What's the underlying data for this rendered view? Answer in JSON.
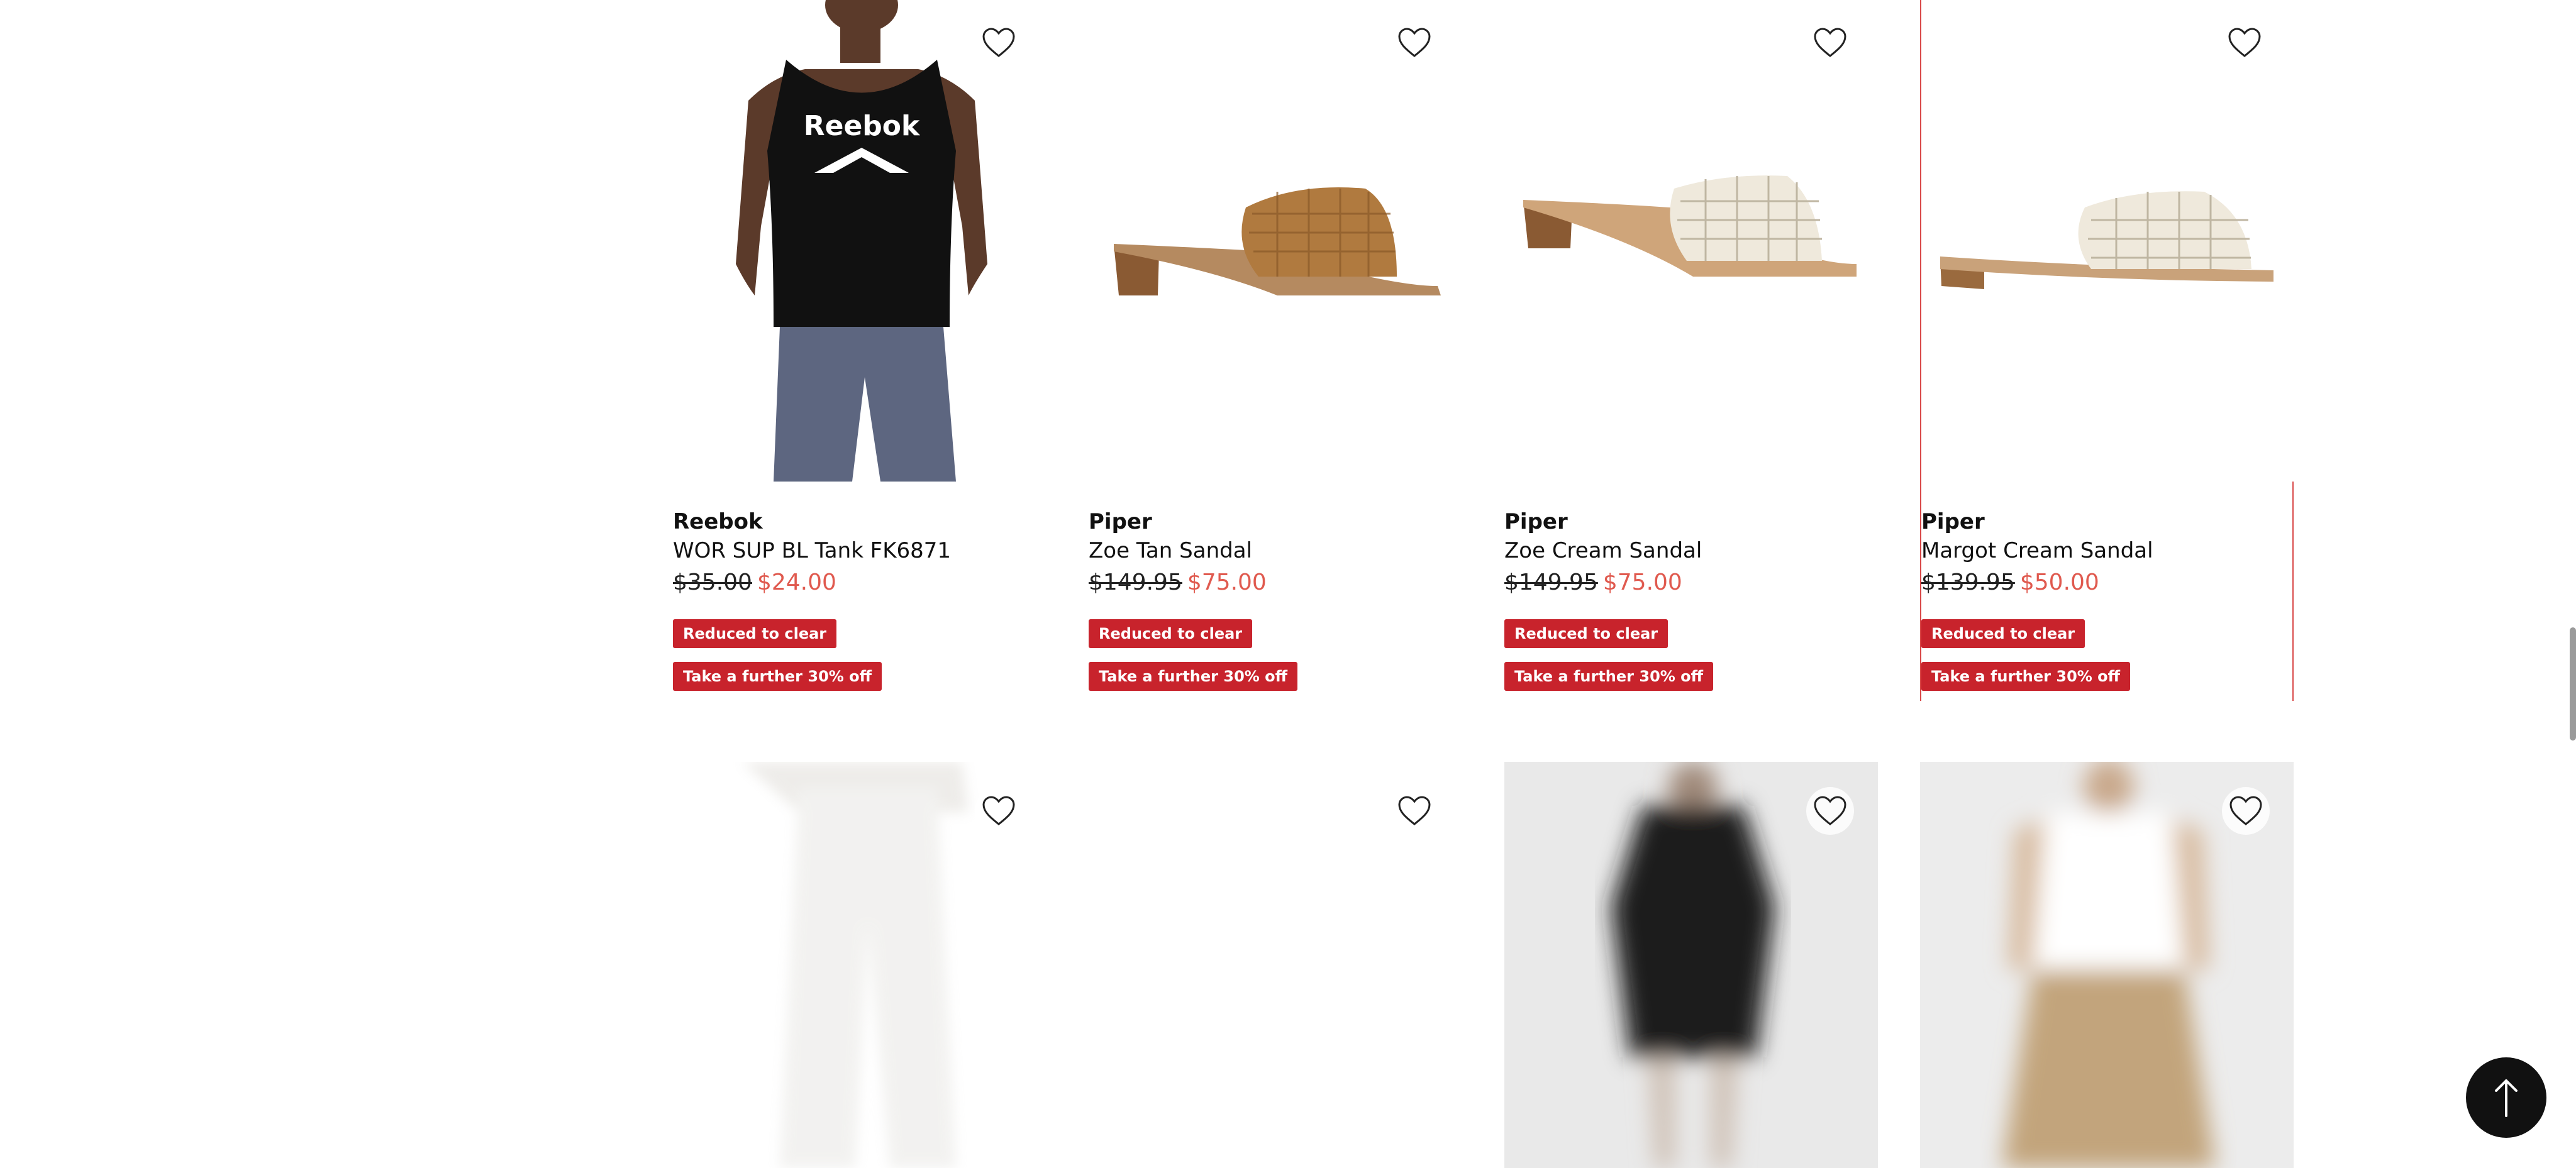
{
  "products": [
    {
      "brand": "Reebok",
      "name": "WOR SUP BL Tank FK6871",
      "was_price": "$35.00",
      "now_price": "$24.00",
      "badges": [
        "Reduced to clear",
        "Take a further 30% off"
      ],
      "image_icon": "model-tank-top-image"
    },
    {
      "brand": "Piper",
      "name": "Zoe Tan Sandal",
      "was_price": "$149.95",
      "now_price": "$75.00",
      "badges": [
        "Reduced to clear",
        "Take a further 30% off"
      ],
      "image_icon": "tan-woven-sandal-image"
    },
    {
      "brand": "Piper",
      "name": "Zoe Cream Sandal",
      "was_price": "$149.95",
      "now_price": "$75.00",
      "badges": [
        "Reduced to clear",
        "Take a further 30% off"
      ],
      "image_icon": "cream-woven-sandal-image"
    },
    {
      "brand": "Piper",
      "name": "Margot Cream Sandal",
      "was_price": "$139.95",
      "now_price": "$50.00",
      "badges": [
        "Reduced to clear",
        "Take a further 30% off"
      ],
      "image_icon": "cream-flat-sandal-image"
    }
  ],
  "row2_images": [
    "loading-pants-image",
    "loading-blank-image",
    "loading-black-dress-image",
    "loading-white-top-image"
  ],
  "icons": {
    "favourite": "heart-outline-icon",
    "back_to_top": "arrow-up-icon"
  },
  "colors": {
    "sale_price": "#e05a4f",
    "badge_bg": "#c8232c",
    "focus_outline": "#d94a4a"
  }
}
